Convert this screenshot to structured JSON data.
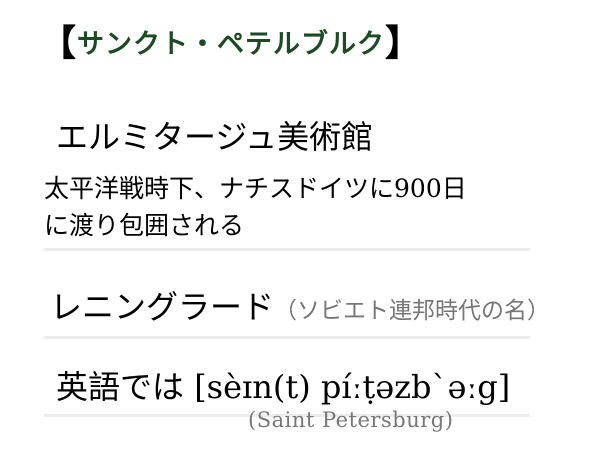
{
  "title": {
    "open_bracket": "【",
    "text": "サンクト・ペテルブルク",
    "close_bracket": "】"
  },
  "entries": {
    "museum": "エルミタージュ美術館",
    "history_line1": "太平洋戦時下、ナチスドイツに900日",
    "history_line2": "に渡り包囲される",
    "former_name": "レニングラード",
    "former_name_note": "（ソビエト連邦時代の名）",
    "english_prefix": "英語では",
    "english_ipa": "[sèɪn(t) píːṭəzbˋəːg]",
    "english_spelling": "(Saint Petersburg)"
  },
  "colors": {
    "title_text": "#1d4a24",
    "bracket": "#000000",
    "note_text": "#777777",
    "divider": "#ececec"
  }
}
